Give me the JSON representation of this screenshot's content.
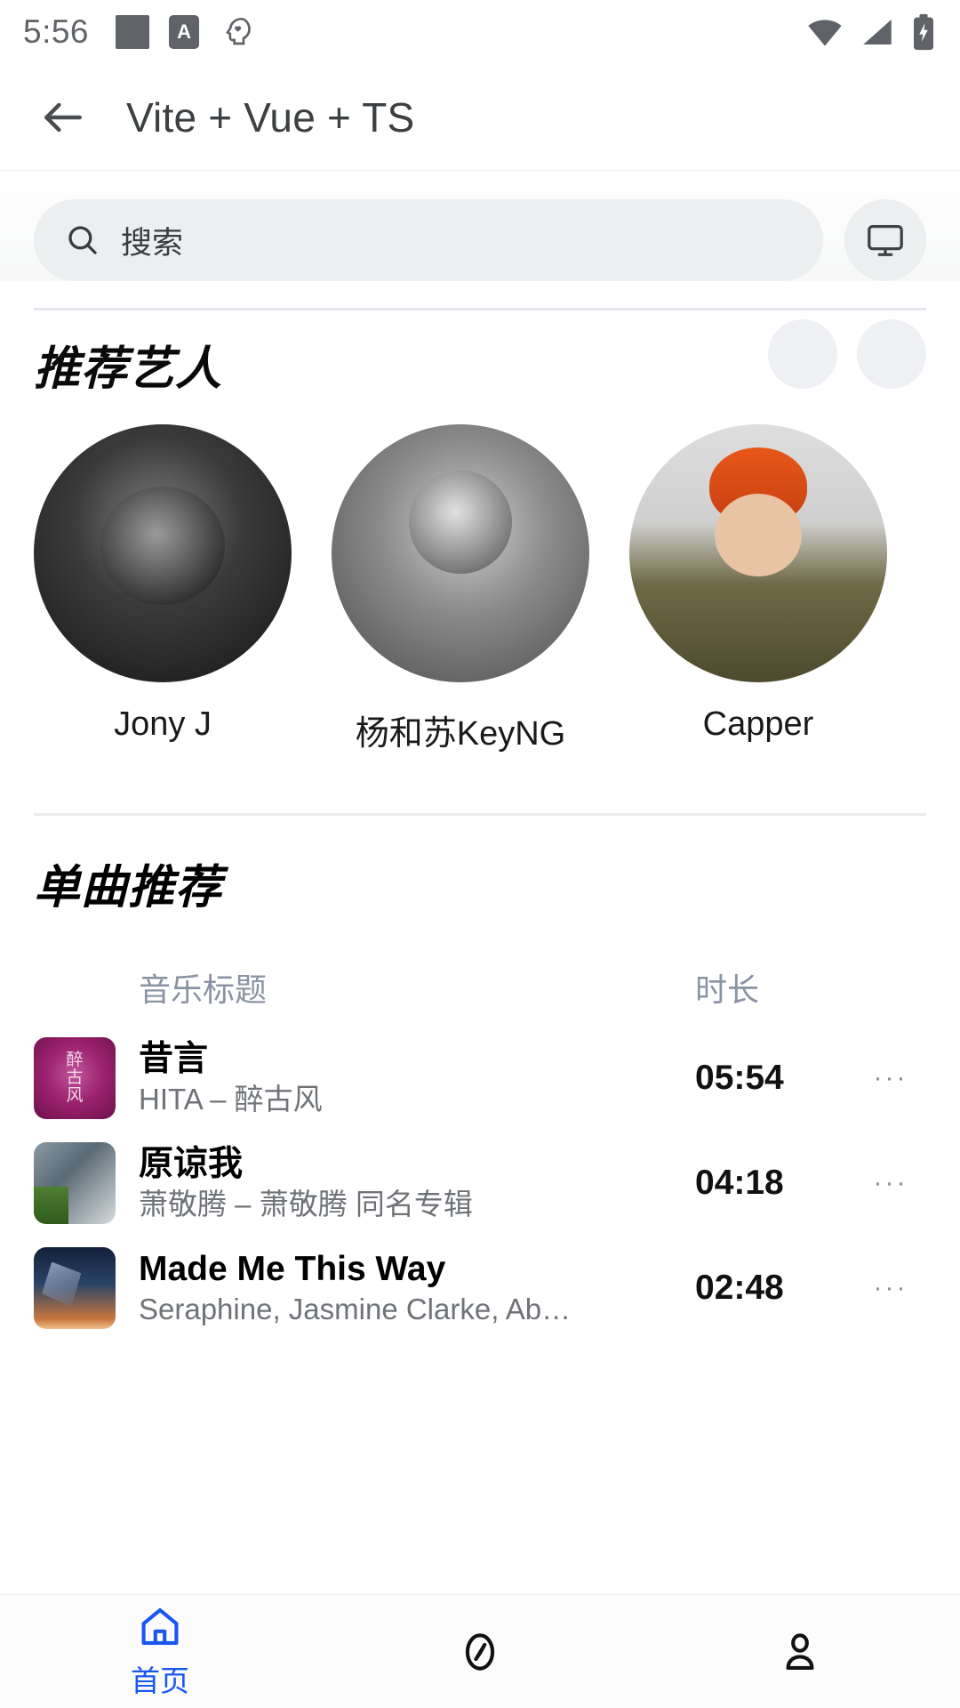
{
  "status_bar": {
    "time": "5:56",
    "icons_left": [
      "square-icon",
      "a-badge-icon",
      "head-mind-icon"
    ],
    "icons_right": [
      "wifi-icon",
      "cellular-signal-icon",
      "battery-charging-icon"
    ]
  },
  "header": {
    "back_icon": "back-arrow-icon",
    "title": "Vite + Vue + TS"
  },
  "search": {
    "icon": "search-icon",
    "placeholder": "搜索",
    "value": "",
    "right_button_icon": "monitor-icon"
  },
  "artists_section": {
    "title": "推荐艺人",
    "items": [
      {
        "name": "Jony J"
      },
      {
        "name": "杨和苏KeyNG"
      },
      {
        "name": "Capper"
      }
    ]
  },
  "songs_section": {
    "title": "单曲推荐",
    "columns": {
      "title": "音乐标题",
      "duration": "时长"
    },
    "rows": [
      {
        "title": "昔言",
        "subtitle": "HITA – 醉古风",
        "duration": "05:54",
        "more": "···"
      },
      {
        "title": "原谅我",
        "subtitle": "萧敬腾 – 萧敬腾 同名专辑",
        "duration": "04:18",
        "more": "···"
      },
      {
        "title": "Made Me This Way",
        "subtitle": "Seraphine, Jasmine Clarke, Ab…",
        "duration": "02:48",
        "more": "···"
      }
    ]
  },
  "bottom_nav": {
    "active_color": "#1a56f0",
    "items": [
      {
        "label": "首页",
        "icon": "home-icon",
        "active": true
      },
      {
        "label": "",
        "icon": "compass-icon",
        "active": false
      },
      {
        "label": "",
        "icon": "person-icon",
        "active": false
      }
    ]
  },
  "colors": {
    "accent": "#1a56f0",
    "text_primary": "#000000",
    "text_secondary": "#6f7378",
    "column_header": "#8a93a3",
    "search_bg": "#eceeef"
  }
}
